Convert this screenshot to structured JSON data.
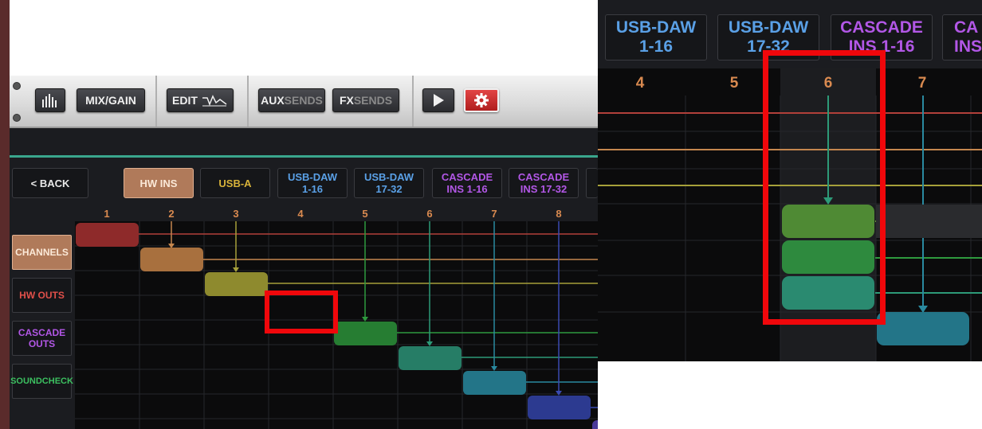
{
  "toolbar": {
    "mix_gain": "MIX/GAIN",
    "edit": "EDIT",
    "aux_prefix": "AUX",
    "aux_suffix": "SENDS",
    "fx_prefix": "FX",
    "fx_suffix": "SENDS"
  },
  "tabs": {
    "back": "< BACK",
    "items": [
      {
        "line1": "HW INS",
        "line2": "",
        "color": "#f3d2b0"
      },
      {
        "line1": "USB-A",
        "line2": "",
        "color": "#d8b33a"
      },
      {
        "line1": "USB-DAW",
        "line2": "1-16",
        "color": "#5aa0e6"
      },
      {
        "line1": "USB-DAW",
        "line2": "17-32",
        "color": "#5aa0e6"
      },
      {
        "line1": "CASCADE",
        "line2": "INS 1-16",
        "color": "#b257e6"
      },
      {
        "line1": "CASCADE",
        "line2": "INS 17-32",
        "color": "#b257e6"
      }
    ]
  },
  "columns": [
    "1",
    "2",
    "3",
    "4",
    "5",
    "6",
    "7",
    "8"
  ],
  "side_buttons": {
    "channels": "CHANNELS",
    "hw_outs": "HW OUTS",
    "cascade_line1": "CASCADE",
    "cascade_line2": "OUTS",
    "soundcheck": "SOUNDCHECK"
  },
  "zoom": {
    "tabs": [
      {
        "line1": "USB-DAW",
        "line2": "1-16",
        "color": "#5aa0e6"
      },
      {
        "line1": "USB-DAW",
        "line2": "17-32",
        "color": "#5aa0e6"
      },
      {
        "line1": "CASCADE",
        "line2": "INS 1-16",
        "color": "#b257e6"
      },
      {
        "line1": "CA",
        "line2": "INS",
        "color": "#b257e6"
      }
    ],
    "columns": [
      "4",
      "5",
      "6",
      "7"
    ]
  },
  "colors": {
    "accent_teal": "#3aa68d",
    "highlight_red": "#f0070b",
    "gear_red": "#d23030"
  }
}
